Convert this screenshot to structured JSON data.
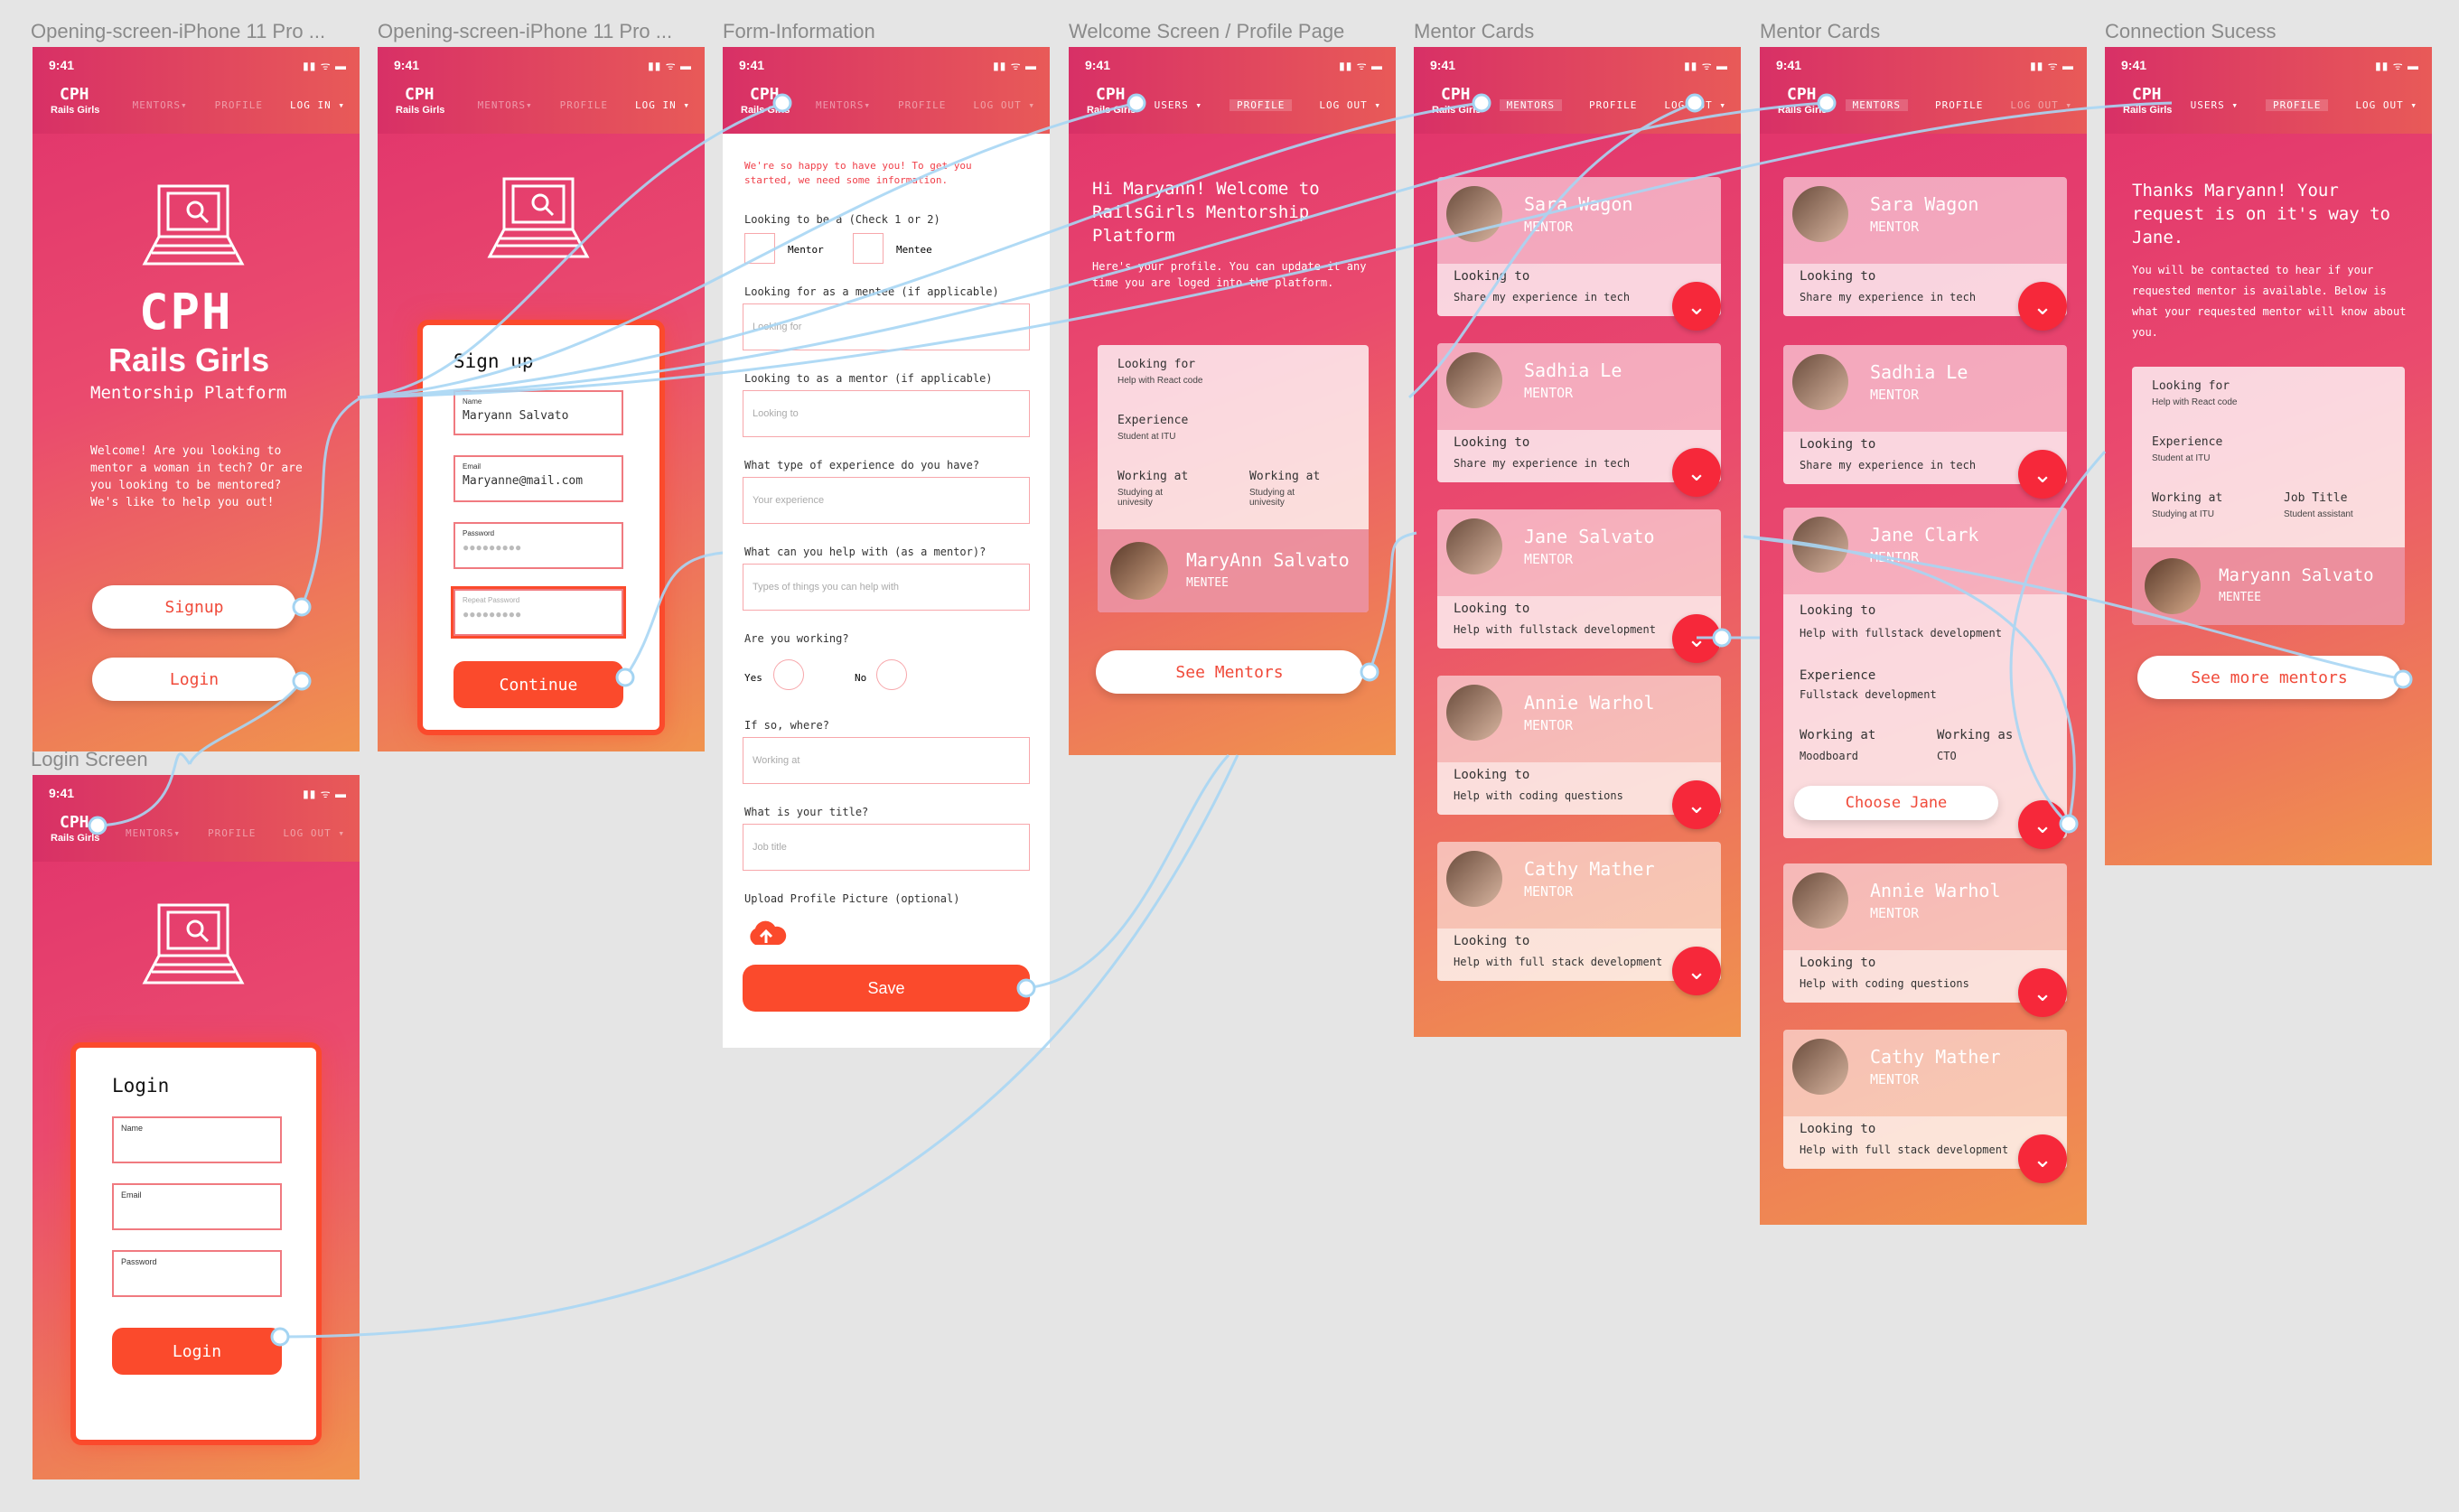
{
  "labels": {
    "f1": "Opening-screen-iPhone 11 Pro ...",
    "f2": "Opening-screen-iPhone 11 Pro ...",
    "f3": "Form-Information",
    "f4": "Welcome Screen / Profile Page",
    "f5": "Mentor Cards",
    "f6": "Mentor Cards",
    "f7": "Connection Sucess",
    "f8": "Login Screen"
  },
  "status": {
    "time": "9:41",
    "signal": "▮▮ ᯤ ▬"
  },
  "nav": {
    "logo": "CPH",
    "brand": "Rails Girls",
    "mentors": "MENTORS",
    "mentors_dd": "MENTORS▾",
    "profile": "PROFILE",
    "login": "LOG IN ▾",
    "logout": "LOG OUT ▾",
    "users": "USERS ▾"
  },
  "opening": {
    "big": "CPH",
    "title": "Rails Girls",
    "subtitle": "Mentorship Platform",
    "welcome": "Welcome! Are you looking to mentor a woman in tech? Or are you looking to be mentored? We's like to help you out!",
    "signup": "Signup",
    "login": "Login"
  },
  "signup": {
    "title": "Sign up",
    "name_label": "Name",
    "name_value": "Maryann Salvato",
    "email_label": "Email",
    "email_value": "Maryanne@mail.com",
    "password_label": "Password",
    "password_value": "●●●●●●●●●",
    "repeat_label": "Repeat Password",
    "repeat_value": "●●●●●●●●●",
    "continue": "Continue"
  },
  "login": {
    "title": "Login",
    "name": "Name",
    "email": "Email",
    "password": "Password",
    "button": "Login"
  },
  "form": {
    "intro": "We're so happy to have you! To get you started, we need some information.",
    "q1": "Looking to be a (Check 1 or 2)",
    "opt_mentor": "Mentor",
    "opt_mentee": "Mentee",
    "q2": "Looking for as a mentee (if applicable)",
    "p2": "Looking for",
    "q3": "Looking to as a mentor (if applicable)",
    "p3": "Looking to",
    "q4": "What type of experience do you have?",
    "p4": "Your experience",
    "q5": "What can you help with (as a mentor)?",
    "p5": "Types of things you can help with",
    "q6": "Are you working?",
    "yes": "Yes",
    "no": "No",
    "q7": "If so, where?",
    "p7": "Working at",
    "q8": "What is your title?",
    "p8": "Job title",
    "q9": "Upload Profile Picture (optional)",
    "save": "Save"
  },
  "welcome": {
    "greeting": "Hi Maryann! Welcome to RailsGirls Mentorship Platform",
    "sub": "Here's your profile. You can update it any time you are loged into the platform.",
    "looking_for": "Looking for",
    "looking_for_v": "Help with React code",
    "experience": "Experience",
    "experience_v": "Student at ITU",
    "working": "Working at",
    "working_v": "Studying at univesity",
    "working2": "Working at",
    "working2_v": "Studying at univesity",
    "name": "MaryAnn Salvato",
    "role": "MENTEE",
    "see": "See Mentors"
  },
  "mentors": [
    {
      "name": "Sara Wagon",
      "role": "MENTOR",
      "label": "Looking to",
      "text": "Share my experience in tech"
    },
    {
      "name": "Sadhia Le",
      "role": "MENTOR",
      "label": "Looking to",
      "text": "Share my experience in tech"
    },
    {
      "name": "Jane Salvato",
      "role": "MENTOR",
      "label": "Looking to",
      "text": "Help with fullstack development"
    },
    {
      "name": "Annie Warhol",
      "role": "MENTOR",
      "label": "Looking to",
      "text": "Help with coding questions"
    },
    {
      "name": "Cathy Mather",
      "role": "MENTOR",
      "label": "Looking to",
      "text": "Help with full stack development"
    }
  ],
  "expanded": {
    "name": "Jane Clark",
    "role": "MENTOR",
    "label": "Looking to",
    "text": "Help with fullstack development",
    "exp": "Experience",
    "exp_v": "Fullstack development",
    "w1": "Working at",
    "w1_v": "Moodboard",
    "w2": "Working as",
    "w2_v": "CTO",
    "choose": "Choose Jane"
  },
  "success": {
    "title": "Thanks Maryann! Your request is on it's way to Jane.",
    "body": "You will be contacted to hear if your requested mentor is available. Below is what your requested mentor will know about you.",
    "looking_for": "Looking for",
    "looking_for_v": "Help with React code",
    "experience": "Experience",
    "experience_v": "Student at ITU",
    "working": "Working at",
    "working_v": "Studying at ITU",
    "title2": "Job Title",
    "title2_v": "Student assistant",
    "name": "Maryann Salvato",
    "role": "MENTEE",
    "more": "See more mentors"
  }
}
